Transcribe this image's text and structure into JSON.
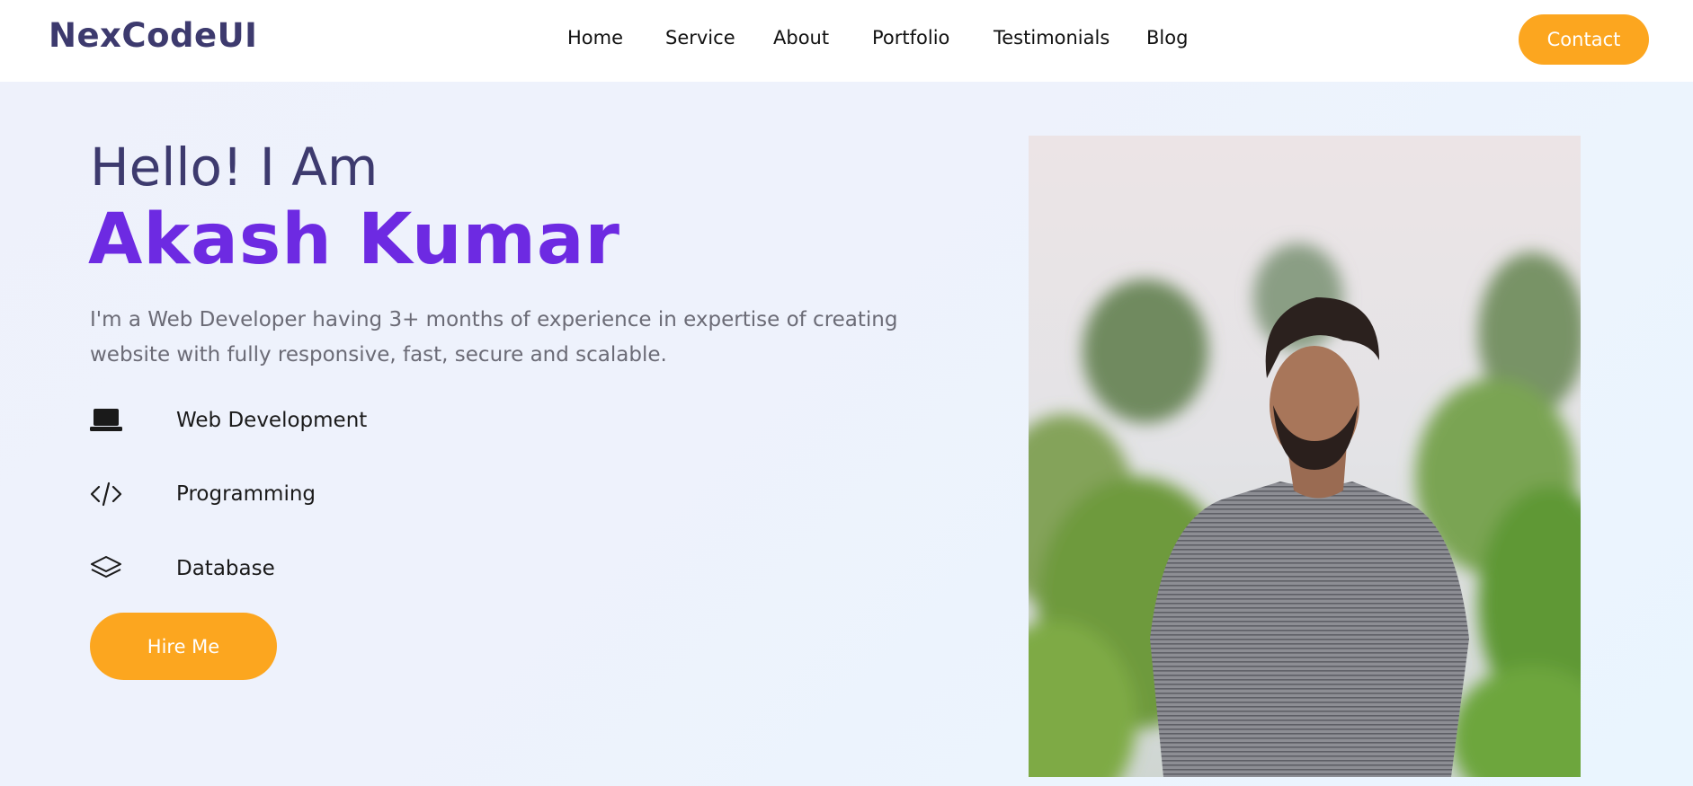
{
  "brand": {
    "name": "NexCodeUI"
  },
  "nav": {
    "items": [
      "Home",
      "Service",
      "About",
      "Portfolio",
      "Testimonials",
      "Blog"
    ],
    "contact_label": "Contact"
  },
  "hero": {
    "greeting": "Hello! I Am",
    "name": "Akash Kumar",
    "description": "I'm a Web Developer having 3+ months of experience in expertise of creating website with fully responsive, fast, secure and scalable.",
    "skills": [
      {
        "label": "Web Development",
        "icon": "laptop-icon"
      },
      {
        "label": "Programming",
        "icon": "code-icon"
      },
      {
        "label": "Database",
        "icon": "layers-icon"
      }
    ],
    "hire_label": "Hire Me"
  },
  "colors": {
    "brand_text": "#3d3a6e",
    "accent_purple": "#6d2ae2",
    "accent_orange": "#fca61f"
  }
}
